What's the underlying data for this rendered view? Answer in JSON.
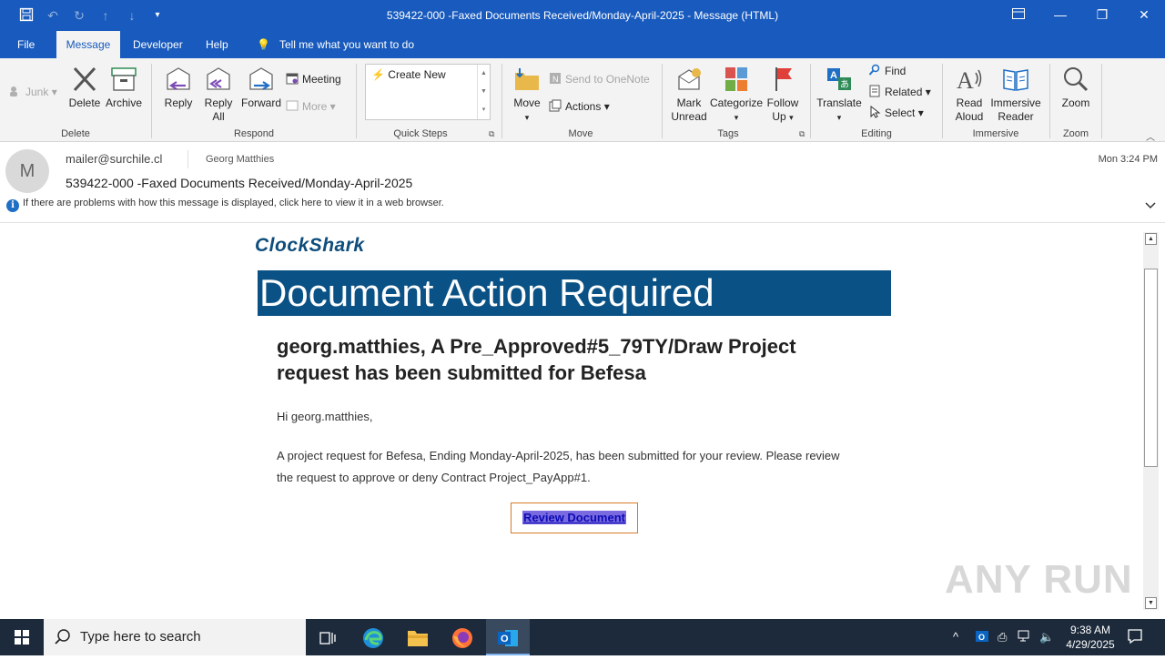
{
  "window": {
    "title": "539422-000 -Faxed Documents Received/Monday-April-2025  -  Message (HTML)"
  },
  "tabs": [
    "File",
    "Message",
    "Developer",
    "Help"
  ],
  "tell_me": "Tell me what you want to do",
  "ribbon": {
    "junk": "Junk",
    "delete": "Delete",
    "archive": "Archive",
    "group_delete": "Delete",
    "reply": "Reply",
    "reply_all_1": "Reply",
    "reply_all_2": "All",
    "forward": "Forward",
    "meeting": "Meeting",
    "more": "More",
    "group_respond": "Respond",
    "create_new": "Create New",
    "group_quick_steps": "Quick Steps",
    "move": "Move",
    "send_onenote": "Send to OneNote",
    "actions": "Actions",
    "group_move": "Move",
    "mark_unread_1": "Mark",
    "mark_unread_2": "Unread",
    "categorize": "Categorize",
    "follow_up_1": "Follow",
    "follow_up_2": "Up",
    "group_tags": "Tags",
    "translate": "Translate",
    "find": "Find",
    "related": "Related",
    "select": "Select",
    "group_editing": "Editing",
    "read_aloud_1": "Read",
    "read_aloud_2": "Aloud",
    "immersive_1": "Immersive",
    "immersive_2": "Reader",
    "group_immersive": "Immersive",
    "zoom": "Zoom",
    "group_zoom": "Zoom"
  },
  "message": {
    "avatar_letter": "M",
    "from": "mailer@surchile.cl",
    "to": "Georg Matthies",
    "subject": "539422-000 -Faxed Documents Received/Monday-April-2025",
    "date": "Mon 3:24 PM",
    "info_bar": "If there are problems with how this message is displayed, click here to view it in a web browser."
  },
  "email": {
    "logo": "ClockShark",
    "banner": "Document Action Required",
    "headline": "georg.matthies, A Pre_Approved#5_79TY/Draw Project request has been submitted for Befesa",
    "greeting": "Hi georg.matthies,",
    "paragraph": "A project request for Befesa, Ending Monday-April-2025, has been submitted for your review. Please review the request to approve or deny Contract Project_PayApp#1.",
    "cta": "Review Document"
  },
  "watermark": "ANY RUN",
  "taskbar": {
    "search_placeholder": "Type here to search",
    "time": "9:38 AM",
    "date": "4/29/2025"
  }
}
